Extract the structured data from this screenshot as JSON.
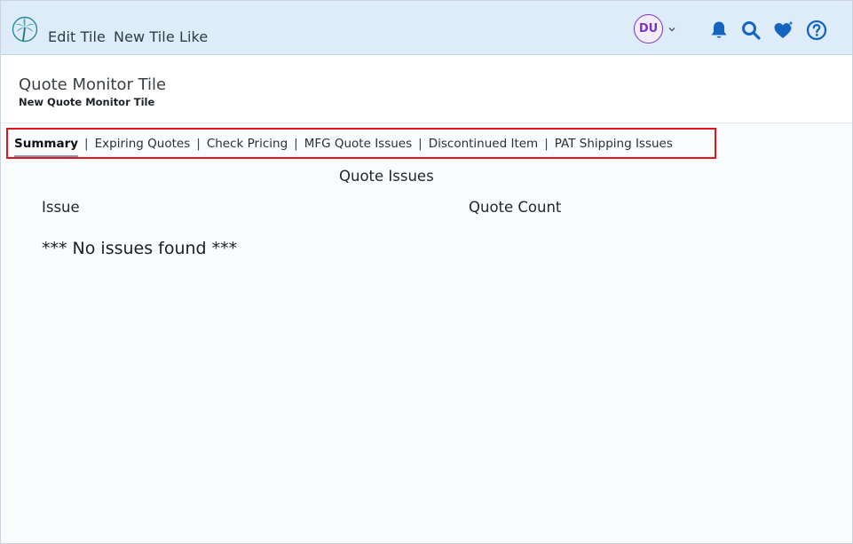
{
  "topbar": {
    "links": [
      "Edit Tile",
      "New Tile Like"
    ],
    "avatar_initials": "DU",
    "icons": [
      "palm-tree-logo",
      "chevron-down-icon",
      "bell-icon",
      "search-icon",
      "sparkle-heart-icon",
      "help-icon"
    ]
  },
  "header": {
    "title": "Quote Monitor Tile",
    "subtitle": "New Quote Monitor Tile"
  },
  "tabs": [
    {
      "label": "Summary",
      "active": true
    },
    {
      "label": "Expiring Quotes",
      "active": false
    },
    {
      "label": "Check Pricing",
      "active": false
    },
    {
      "label": "MFG Quote Issues",
      "active": false
    },
    {
      "label": "Discontinued Item",
      "active": false
    },
    {
      "label": "PAT Shipping Issues",
      "active": false
    }
  ],
  "tab_separator": "|",
  "content": {
    "section_title": "Quote Issues",
    "columns": [
      "Issue",
      "Quote Count"
    ],
    "empty_message": "*** No issues found ***"
  },
  "colors": {
    "topbar_bg": "#deebf9",
    "icon_blue": "#1565c0",
    "avatar_purple": "#7b33c3",
    "highlight_red": "#e4121b"
  }
}
